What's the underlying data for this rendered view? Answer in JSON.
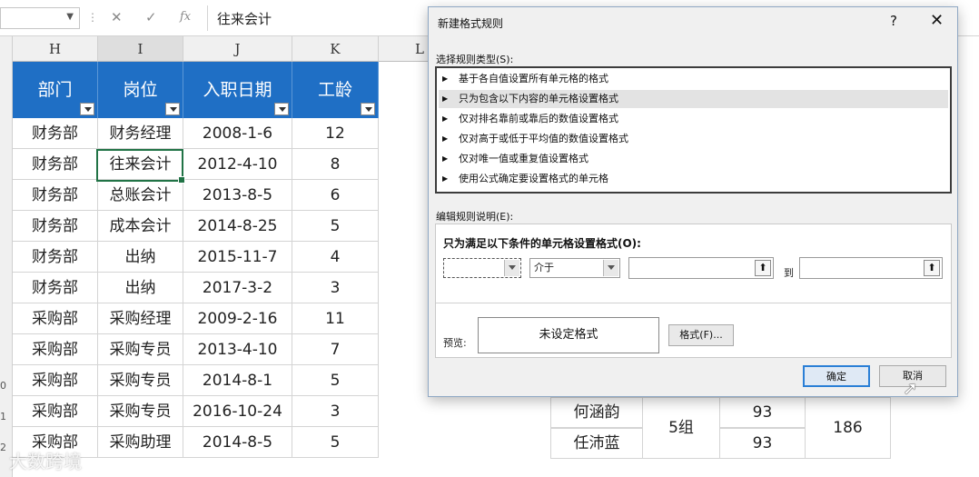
{
  "formula_bar": {
    "cancel_icon": "✕",
    "enter_icon": "✓",
    "fx_label": "fx",
    "content": "往来会计"
  },
  "columns": [
    "H",
    "I",
    "J",
    "K",
    "L"
  ],
  "table": {
    "headers": [
      "部门",
      "岗位",
      "入职日期",
      "工龄"
    ],
    "rows": [
      [
        "财务部",
        "财务经理",
        "2008-1-6",
        "12"
      ],
      [
        "财务部",
        "往来会计",
        "2012-4-10",
        "8"
      ],
      [
        "财务部",
        "总账会计",
        "2013-8-5",
        "6"
      ],
      [
        "财务部",
        "成本会计",
        "2014-8-25",
        "5"
      ],
      [
        "财务部",
        "出纳",
        "2015-11-7",
        "4"
      ],
      [
        "财务部",
        "出纳",
        "2017-3-2",
        "3"
      ],
      [
        "采购部",
        "采购经理",
        "2009-2-16",
        "11"
      ],
      [
        "采购部",
        "采购专员",
        "2013-4-10",
        "7"
      ],
      [
        "采购部",
        "采购专员",
        "2014-8-1",
        "5"
      ],
      [
        "采购部",
        "采购专员",
        "2016-10-24",
        "3"
      ],
      [
        "采购部",
        "采购助理",
        "2014-8-5",
        "5"
      ]
    ]
  },
  "row_numbers_partial": [
    "0",
    "1",
    "2"
  ],
  "right_table": {
    "names": [
      "何涵韵",
      "任沛蓝"
    ],
    "group": "5组",
    "scores": [
      "93",
      "93"
    ],
    "total": "186"
  },
  "watermark": "大数跨境",
  "dialog": {
    "title": "新建格式规则",
    "help": "?",
    "close": "✕",
    "select_type_label": "选择规则类型(S):",
    "rule_types": [
      "基于各自值设置所有单元格的格式",
      "只为包含以下内容的单元格设置格式",
      "仅对排名靠前或靠后的数值设置格式",
      "仅对高于或低于平均值的数值设置格式",
      "仅对唯一值或重复值设置格式",
      "使用公式确定要设置格式的单元格"
    ],
    "selected_index": 1,
    "edit_desc_label": "编辑规则说明(E):",
    "condition_label": "只为满足以下条件的单元格设置格式(O):",
    "combo1_value": "",
    "combo2_value": "介于",
    "to_label": "到",
    "upload_icon": "⬆",
    "preview_label": "预览:",
    "preview_text": "未设定格式",
    "format_button": "格式(F)...",
    "ok_button": "确定",
    "cancel_button": "取消"
  }
}
